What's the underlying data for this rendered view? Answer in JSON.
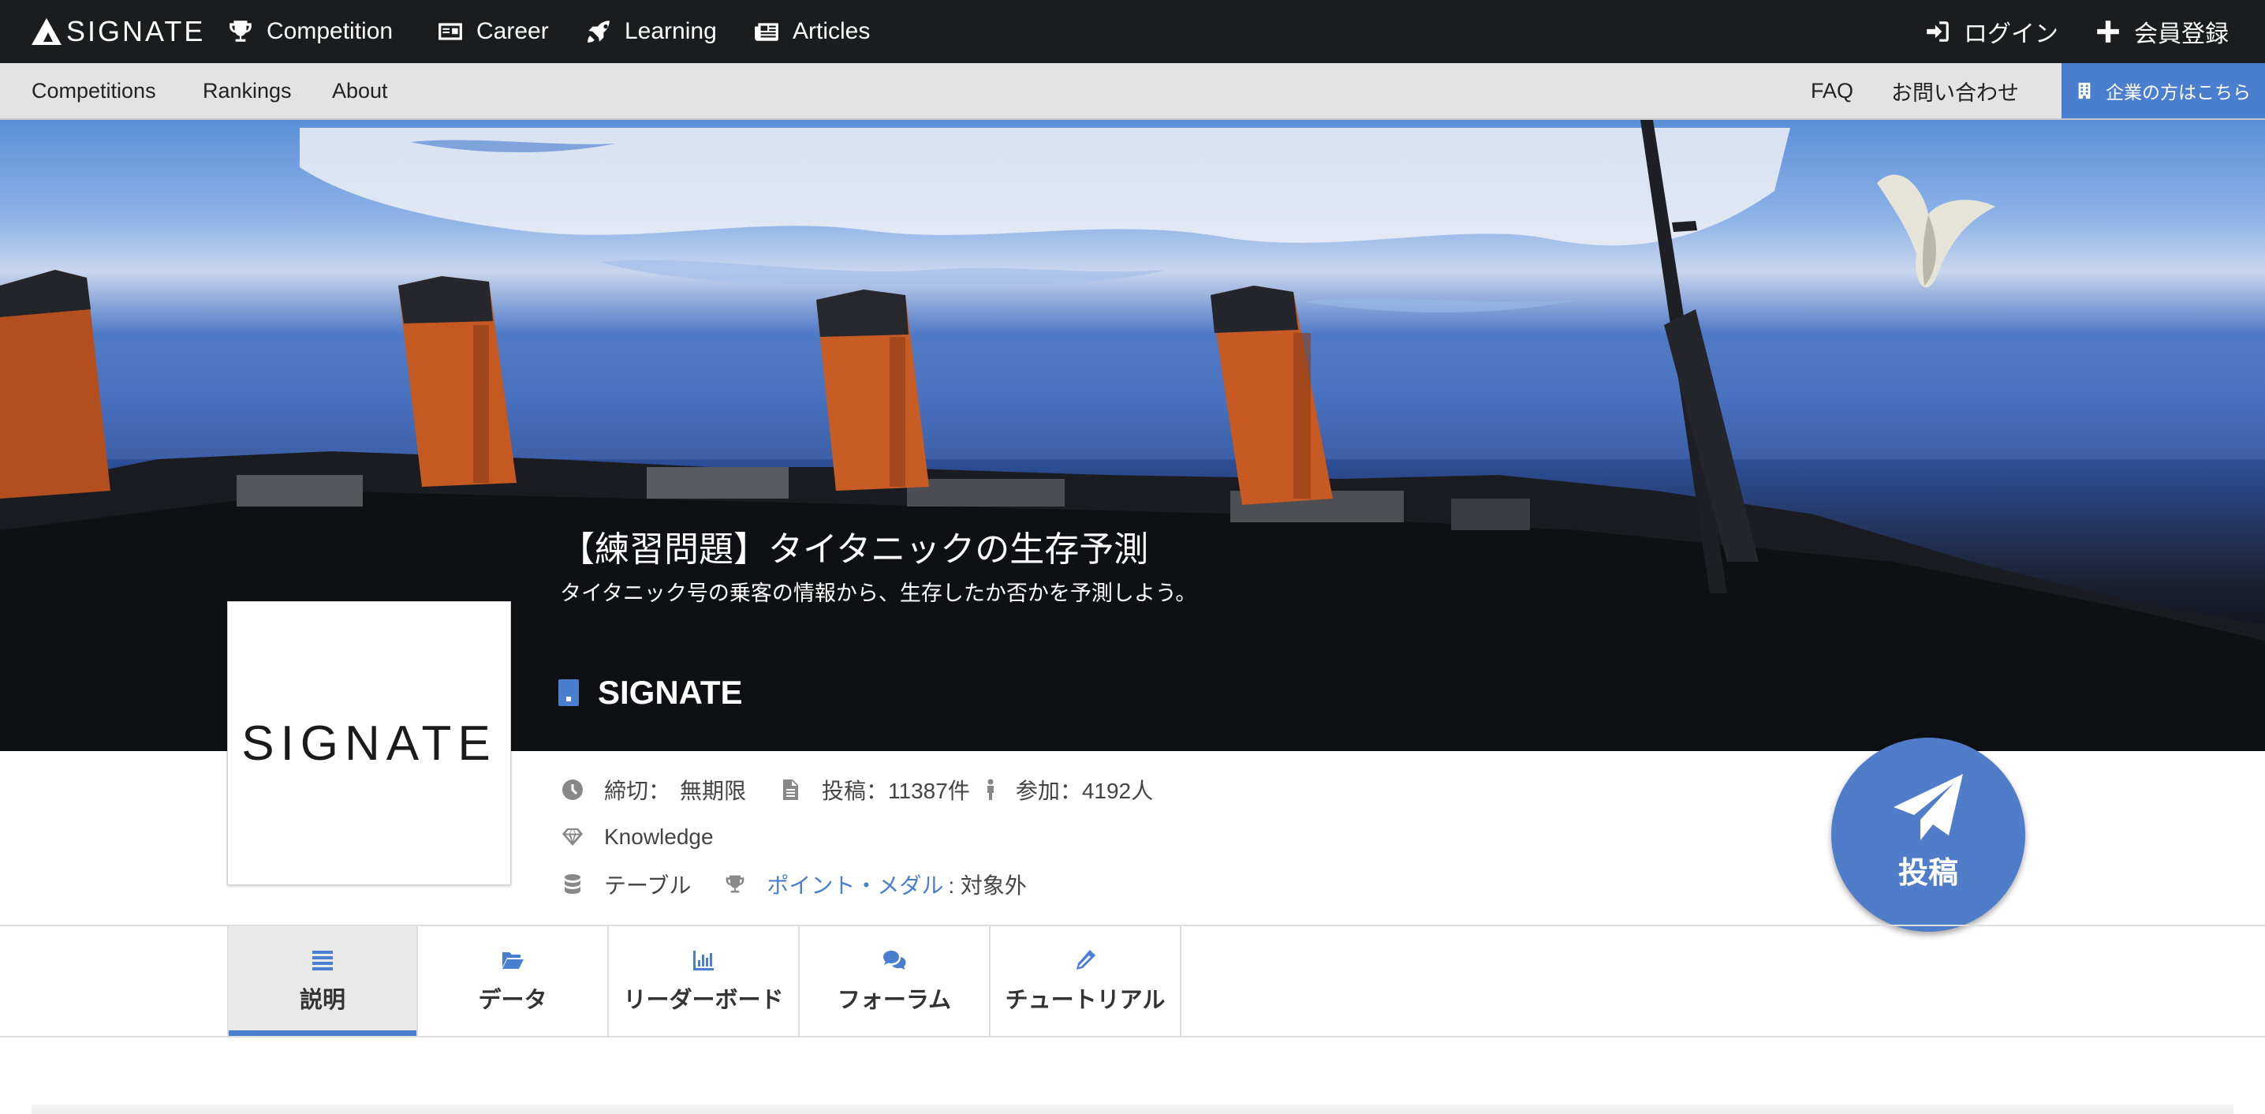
{
  "brand": {
    "logo_text": "SIGNATE"
  },
  "topnav": {
    "items": [
      {
        "label": "Competition",
        "icon": "trophy-icon"
      },
      {
        "label": "Career",
        "icon": "id-card-icon"
      },
      {
        "label": "Learning",
        "icon": "rocket-icon"
      },
      {
        "label": "Articles",
        "icon": "newspaper-icon"
      }
    ],
    "login_label": "ログイン",
    "register_label": "会員登録"
  },
  "subnav": {
    "items": [
      "Competitions",
      "Rankings",
      "About"
    ],
    "faq_label": "FAQ",
    "contact_label": "お問い合わせ",
    "corporate_label": "企業の方はこちら"
  },
  "hero": {
    "title": "【練習問題】タイタニックの生存予測",
    "subtitle": "タイタニック号の乗客の情報から、生存したか否かを予測しよう。",
    "organizer": "SIGNATE"
  },
  "logo_card": {
    "text": "SIGNATE"
  },
  "meta": {
    "deadline_label": "締切：",
    "deadline_value": "無期限",
    "submissions": "投稿：11387件",
    "participants": "参加：4192人",
    "competition_type": "Knowledge",
    "data_type": "テーブル",
    "points_link": "ポイント・メダル",
    "points_value": ": 対象外"
  },
  "submit_button": {
    "label": "投稿"
  },
  "tabs": [
    {
      "label": "説明",
      "icon": "list-icon",
      "active": true
    },
    {
      "label": "データ",
      "icon": "folder-open-icon",
      "active": false
    },
    {
      "label": "リーダーボード",
      "icon": "bar-chart-icon",
      "active": false
    },
    {
      "label": "フォーラム",
      "icon": "comments-icon",
      "active": false
    },
    {
      "label": "チュートリアル",
      "icon": "pencil-icon",
      "active": false
    }
  ],
  "colors": {
    "topbar_bg": "#1b1c1e",
    "subbar_bg": "#e3e3e3",
    "accent": "#4a7fd0",
    "fab_bg": "#4f7dc9"
  }
}
